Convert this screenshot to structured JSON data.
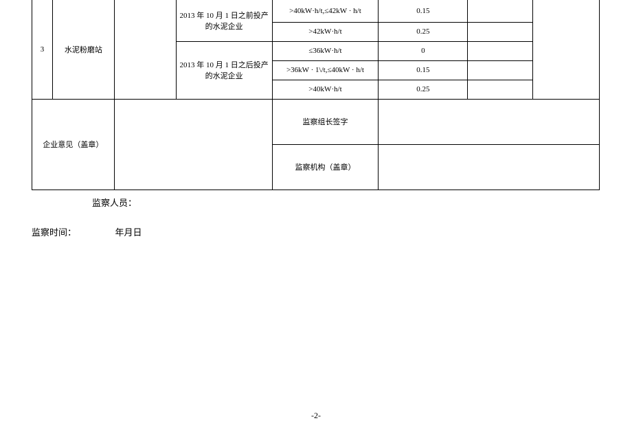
{
  "table": {
    "row_index": "3",
    "row_name": "水泥粉磨站",
    "period_before": "2013 年 10 月 1 日之前投产的水泥企业",
    "period_after": "2013 年 10 月 1 日之后投产的水泥企业",
    "ranges": {
      "r1": ">40kW·h/t,≤42kW · h/t",
      "r2": ">42kW·h/t",
      "r3": "≤36kW·h/t",
      "r4": ">36kW · 1\\/t,≤40kW · h/t",
      "r5": ">40kW·h/t"
    },
    "values": {
      "v1": "0.15",
      "v2": "0.25",
      "v3": "0",
      "v4": "0.15",
      "v5": "0.25"
    },
    "enterprise_opinion": "企业意见（盖章）",
    "sig_leader": "监察组长签字",
    "sig_org": "监察机构（盖章）"
  },
  "footer": {
    "inspector_label": "监察人员：",
    "inspect_time_label": "监察时间：",
    "date_template": "年月日"
  },
  "page_number": "-2-"
}
